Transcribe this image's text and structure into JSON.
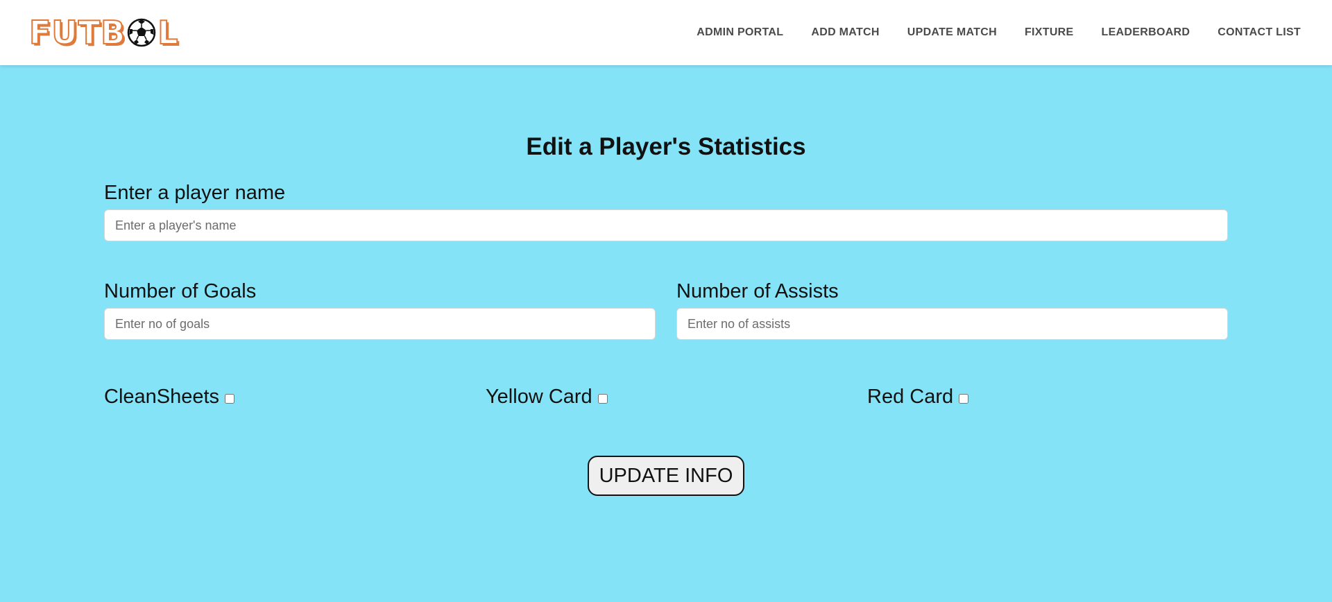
{
  "brand": {
    "logo_letters": "FUTB",
    "logo_tail": "L",
    "logo_icon": "soccer-ball-icon",
    "accent_color": "#e07a3a"
  },
  "nav": {
    "items": [
      {
        "label": "ADMIN PORTAL"
      },
      {
        "label": "ADD MATCH"
      },
      {
        "label": "UPDATE MATCH"
      },
      {
        "label": "FIXTURE"
      },
      {
        "label": "LEADERBOARD"
      },
      {
        "label": "CONTACT LIST"
      }
    ]
  },
  "page": {
    "background_color": "#85e3f7",
    "title": "Edit a Player's Statistics"
  },
  "form": {
    "player_name": {
      "label": "Enter a player name",
      "placeholder": "Enter a player's name",
      "value": ""
    },
    "goals": {
      "label": "Number of Goals",
      "placeholder": "Enter no of goals",
      "value": ""
    },
    "assists": {
      "label": "Number of Assists",
      "placeholder": "Enter no of assists",
      "value": ""
    },
    "checkboxes": {
      "clean_sheets": {
        "label": "CleanSheets",
        "checked": false
      },
      "yellow_card": {
        "label": "Yellow Card",
        "checked": false
      },
      "red_card": {
        "label": "Red Card",
        "checked": false
      }
    },
    "submit_label": "UPDATE INFO"
  }
}
